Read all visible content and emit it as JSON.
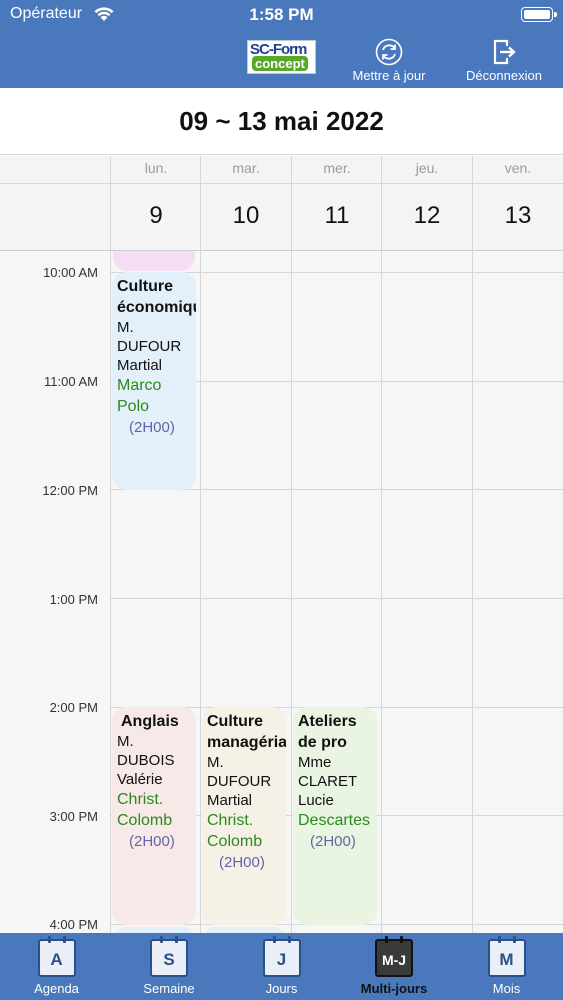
{
  "status": {
    "carrier": "Opérateur",
    "time": "1:58 PM"
  },
  "header": {
    "logo_line1": "SC-Form",
    "logo_line2": "concept",
    "update_label": "Mettre à jour",
    "logout_label": "Déconnexion"
  },
  "range_title": "09 ~ 13 mai 2022",
  "days": [
    {
      "name": "lun.",
      "num": "9"
    },
    {
      "name": "mar.",
      "num": "10"
    },
    {
      "name": "mer.",
      "num": "11"
    },
    {
      "name": "jeu.",
      "num": "12"
    },
    {
      "name": "ven.",
      "num": "13"
    }
  ],
  "times": [
    "10:00 AM",
    "11:00 AM",
    "12:00 PM",
    "1:00 PM",
    "2:00 PM",
    "3:00 PM",
    "4:00 PM"
  ],
  "events": [
    {
      "title": "Culture économique",
      "teacher": "M. DUFOUR Martial",
      "room": "Marco Polo",
      "duration": "(2H00)"
    },
    {
      "title": "Anglais",
      "teacher": "M. DUBOIS Valérie",
      "room": "Christ. Colomb",
      "duration": "(2H00)"
    },
    {
      "title": "Culture managériale",
      "teacher": "M. DUFOUR Martial",
      "room": "Christ. Colomb",
      "duration": "(2H00)"
    },
    {
      "title": "Ateliers de pro",
      "teacher": "Mme CLARET Lucie",
      "room": "Descartes",
      "duration": "(2H00)"
    }
  ],
  "tabs": [
    {
      "letter": "A",
      "label": "Agenda"
    },
    {
      "letter": "S",
      "label": "Semaine"
    },
    {
      "letter": "J",
      "label": "Jours"
    },
    {
      "letter": "M-J",
      "label": "Multi-jours"
    },
    {
      "letter": "M",
      "label": "Mois"
    }
  ],
  "colors": {
    "header_blue": "#4a78bc",
    "event_blue": "#e3eff9",
    "event_pink": "#f7e9e8",
    "event_beige": "#f6f1e6",
    "event_green": "#e9f5e2",
    "event_purple": "#f3def3",
    "room_green": "#2a8a1e",
    "duration_purple": "#6464a8"
  }
}
